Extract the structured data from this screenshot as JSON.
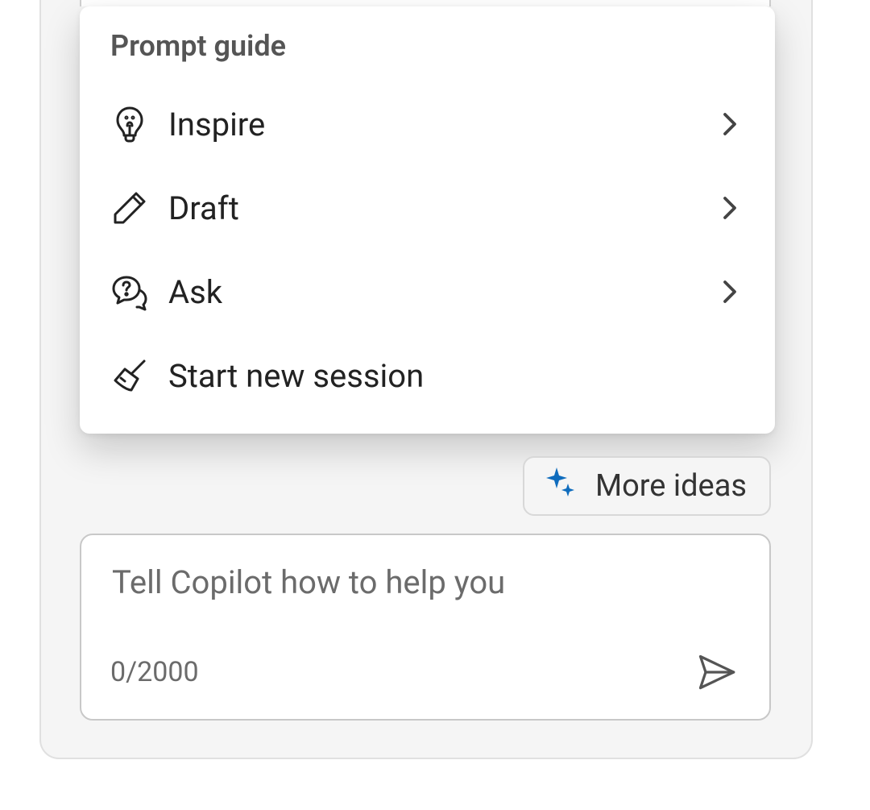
{
  "popup": {
    "title": "Prompt guide",
    "items": [
      {
        "label": "Inspire",
        "has_submenu": true
      },
      {
        "label": "Draft",
        "has_submenu": true
      },
      {
        "label": "Ask",
        "has_submenu": true
      },
      {
        "label": "Start new session",
        "has_submenu": false
      }
    ]
  },
  "more_ideas": {
    "label": "More ideas"
  },
  "input": {
    "placeholder": "Tell Copilot how to help you",
    "counter": "0/2000"
  },
  "colors": {
    "accent": "#0F6CBD"
  }
}
